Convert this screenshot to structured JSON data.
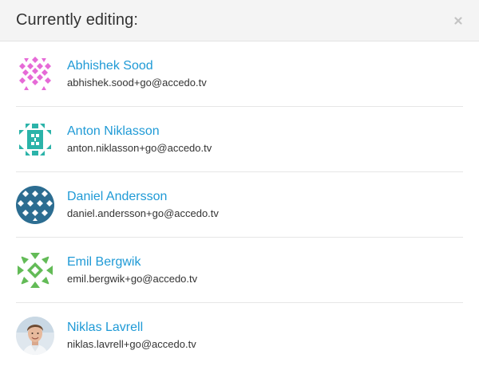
{
  "dialog": {
    "title": "Currently editing:",
    "close_icon": "close-icon"
  },
  "users": [
    {
      "name": "Abhishek Sood",
      "email": "abhishek.sood+go@accedo.tv",
      "avatar_color": "#e66ad7",
      "avatar_icon": "identicon"
    },
    {
      "name": "Anton Niklasson",
      "email": "anton.niklasson+go@accedo.tv",
      "avatar_color": "#2bb3a9",
      "avatar_icon": "identicon"
    },
    {
      "name": "Daniel Andersson",
      "email": "daniel.andersson+go@accedo.tv",
      "avatar_color": "#2c6d91",
      "avatar_icon": "identicon"
    },
    {
      "name": "Emil Bergwik",
      "email": "emil.bergwik+go@accedo.tv",
      "avatar_color": "#63bb57",
      "avatar_icon": "identicon"
    },
    {
      "name": "Niklas Lavrell",
      "email": "niklas.lavrell+go@accedo.tv",
      "avatar_color": "#d8b49a",
      "avatar_icon": "profile-photo"
    }
  ],
  "colors": {
    "link": "#1f9ad6",
    "header_bg": "#f4f4f4",
    "text": "#333333"
  }
}
